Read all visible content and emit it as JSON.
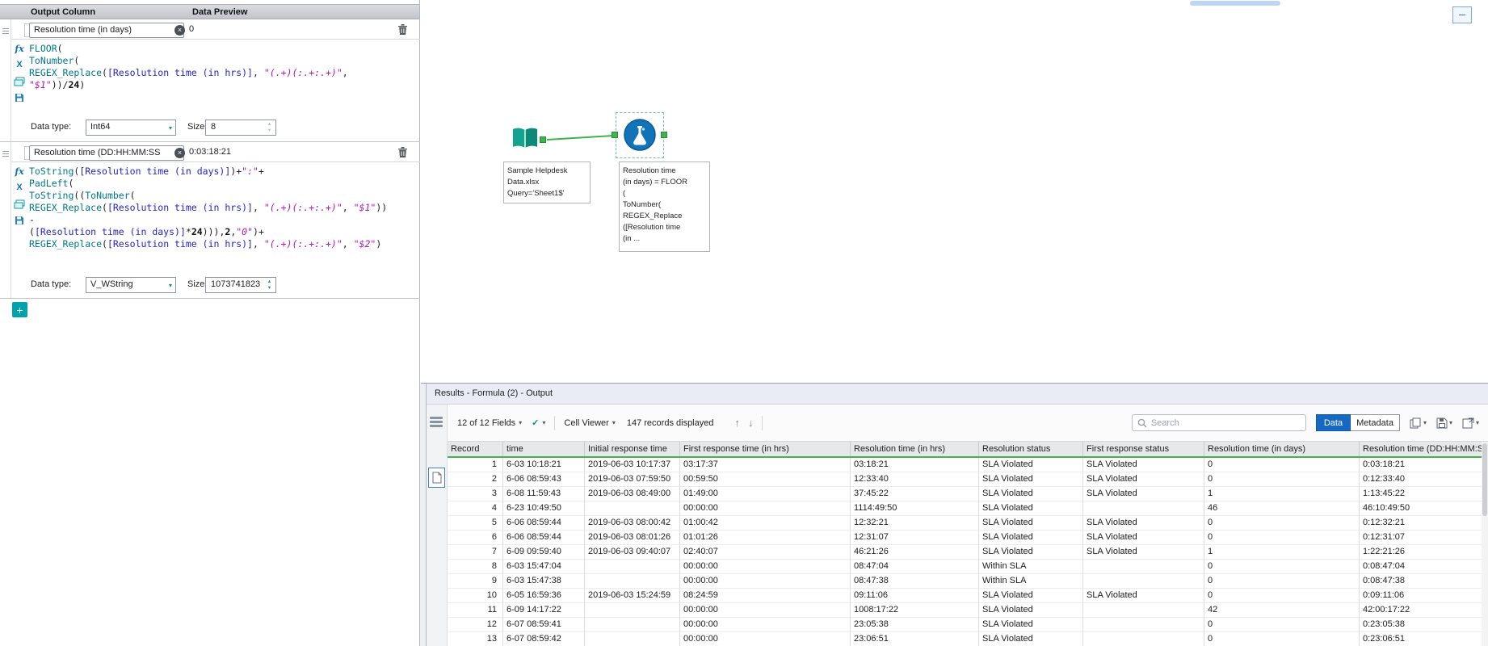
{
  "colors": {
    "accent_green": "#44b24e",
    "accent_blue": "#1568c4",
    "tool_circle_blue": "#1173b8",
    "input_tool_teal": "#12a48e",
    "panel_teal": "#00a3ad"
  },
  "icons": {
    "caret_down": "▾",
    "check": "✓",
    "up_arrow": "↑",
    "down_arrow": "↓",
    "plus": "+",
    "clear": "×",
    "chevron_down": "∨",
    "minimize": "─",
    "spin_up": "▴",
    "spin_down": "▾",
    "fx_label": "fx",
    "x_label": "X"
  },
  "formula_panel": {
    "header": {
      "output_column": "Output Column",
      "data_preview": "Data Preview"
    },
    "expressions": [
      {
        "name": "Resolution time (in days)",
        "preview": "0",
        "data_type_label": "Data type:",
        "data_type": "Int64",
        "size_label": "Size:",
        "size": "8",
        "code": [
          [
            [
              "f",
              "FLOOR"
            ],
            [
              "o",
              "("
            ]
          ],
          [
            [
              "f",
              "ToNumber"
            ],
            [
              "o",
              "("
            ]
          ],
          [
            [
              "f",
              "REGEX_Replace"
            ],
            [
              "o",
              "("
            ],
            [
              "c",
              "[Resolution time (in hrs)]"
            ],
            [
              "o",
              ", "
            ],
            [
              "s",
              "\"(.+)(:.+:.+)\""
            ],
            [
              "o",
              ","
            ]
          ],
          [
            [
              "s",
              "\"$1\""
            ],
            [
              "o",
              "))/"
            ],
            [
              "n",
              "24"
            ],
            [
              "o",
              ")"
            ]
          ]
        ]
      },
      {
        "name": "Resolution time (DD:HH:MM:SS",
        "preview": "0:03:18:21",
        "data_type_label": "Data type:",
        "data_type": "V_WString",
        "size_label": "Size:",
        "size": "1073741823",
        "code": [
          [
            [
              "f",
              "ToString"
            ],
            [
              "o",
              "("
            ],
            [
              "c",
              "[Resolution time (in days)]"
            ],
            [
              "o",
              ")+"
            ],
            [
              "s",
              "\":\""
            ],
            [
              "o",
              "+"
            ]
          ],
          [
            [
              "f",
              "PadLeft"
            ],
            [
              "o",
              "("
            ]
          ],
          [
            [
              "f",
              "ToString"
            ],
            [
              "o",
              "(("
            ],
            [
              "f",
              "ToNumber"
            ],
            [
              "o",
              "("
            ]
          ],
          [
            [
              "f",
              "REGEX_Replace"
            ],
            [
              "o",
              "("
            ],
            [
              "c",
              "[Resolution time (in hrs)]"
            ],
            [
              "o",
              ", "
            ],
            [
              "s",
              "\"(.+)(:.+:.+)\""
            ],
            [
              "o",
              ", "
            ],
            [
              "s",
              "\"$1\""
            ],
            [
              "o",
              "))"
            ]
          ],
          [
            [
              "o",
              "-"
            ]
          ],
          [
            [
              "o",
              "("
            ],
            [
              "c",
              "[Resolution time (in days)]"
            ],
            [
              "o",
              "*"
            ],
            [
              "n",
              "24"
            ],
            [
              "o",
              "))),"
            ],
            [
              "n",
              "2"
            ],
            [
              "o",
              ","
            ],
            [
              "s",
              "\"0\""
            ],
            [
              "o",
              ")+"
            ]
          ],
          [
            [
              "f",
              "REGEX_Replace"
            ],
            [
              "o",
              "("
            ],
            [
              "c",
              "[Resolution time (in hrs)]"
            ],
            [
              "o",
              ", "
            ],
            [
              "s",
              "\"(.+)(:.+:.+)\""
            ],
            [
              "o",
              ", "
            ],
            [
              "s",
              "\"$2\""
            ],
            [
              "o",
              ")"
            ]
          ]
        ]
      }
    ]
  },
  "canvas": {
    "input_tool_label_lines": [
      "Sample Helpdesk",
      "Data.xlsx",
      "Query='Sheet1$'"
    ],
    "formula_annotation_lines": [
      "Resolution time",
      "(in days) = FLOOR",
      "(",
      "ToNumber(",
      "REGEX_Replace",
      "([Resolution time",
      "(in ..."
    ]
  },
  "results": {
    "title": "Results - Formula (2) - Output",
    "toolbar": {
      "fields_summary": "12 of 12 Fields",
      "cell_viewer_label": "Cell Viewer",
      "records_text": "147 records displayed",
      "search_placeholder": "Search",
      "data_label": "Data",
      "metadata_label": "Metadata"
    },
    "table": {
      "columns": [
        "Record",
        "time",
        "Initial response time",
        "First response time (in hrs)",
        "Resolution time (in hrs)",
        "Resolution status",
        "First response status",
        "Resolution time (in days)",
        "Resolution time (DD:HH:MM:SS)"
      ],
      "rows": [
        [
          "1",
          "6-03 10:18:21",
          "2019-06-03 10:17:37",
          "03:17:37",
          "03:18:21",
          "SLA Violated",
          "SLA Violated",
          "0",
          "0:03:18:21"
        ],
        [
          "2",
          "6-06 08:59:43",
          "2019-06-03 07:59:50",
          "00:59:50",
          "12:33:40",
          "SLA Violated",
          "SLA Violated",
          "0",
          "0:12:33:40"
        ],
        [
          "3",
          "6-08 11:59:43",
          "2019-06-03 08:49:00",
          "01:49:00",
          "37:45:22",
          "SLA Violated",
          "SLA Violated",
          "1",
          "1:13:45:22"
        ],
        [
          "4",
          "6-23 10:49:50",
          "",
          "00:00:00",
          "1114:49:50",
          "SLA Violated",
          "",
          "46",
          "46:10:49:50"
        ],
        [
          "5",
          "6-06 08:59:44",
          "2019-06-03 08:00:42",
          "01:00:42",
          "12:32:21",
          "SLA Violated",
          "SLA Violated",
          "0",
          "0:12:32:21"
        ],
        [
          "6",
          "6-06 08:59:44",
          "2019-06-03 08:01:26",
          "01:01:26",
          "12:31:07",
          "SLA Violated",
          "SLA Violated",
          "0",
          "0:12:31:07"
        ],
        [
          "7",
          "6-09 09:59:40",
          "2019-06-03 09:40:07",
          "02:40:07",
          "46:21:26",
          "SLA Violated",
          "SLA Violated",
          "1",
          "1:22:21:26"
        ],
        [
          "8",
          "6-03 15:47:04",
          "",
          "00:00:00",
          "08:47:04",
          "Within SLA",
          "",
          "0",
          "0:08:47:04"
        ],
        [
          "9",
          "6-03 15:47:38",
          "",
          "00:00:00",
          "08:47:38",
          "Within SLA",
          "",
          "0",
          "0:08:47:38"
        ],
        [
          "10",
          "6-05 16:59:36",
          "2019-06-03 15:24:59",
          "08:24:59",
          "09:11:06",
          "SLA Violated",
          "SLA Violated",
          "0",
          "0:09:11:06"
        ],
        [
          "11",
          "6-09 14:17:22",
          "",
          "00:00:00",
          "1008:17:22",
          "SLA Violated",
          "",
          "42",
          "42:00:17:22"
        ],
        [
          "12",
          "6-07 08:59:41",
          "",
          "00:00:00",
          "23:05:38",
          "SLA Violated",
          "",
          "0",
          "0:23:05:38"
        ],
        [
          "13",
          "6-07 08:59:42",
          "",
          "00:00:00",
          "23:06:51",
          "SLA Violated",
          "",
          "0",
          "0:23:06:51"
        ]
      ]
    }
  }
}
